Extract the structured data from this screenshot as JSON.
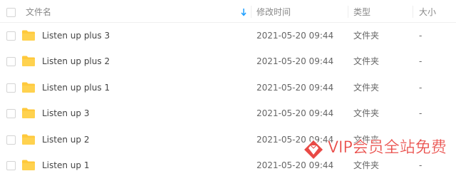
{
  "header": {
    "name_label": "文件名",
    "modified_label": "修改时间",
    "type_label": "类型",
    "size_label": "大小",
    "sort_icon": "sort-arrow-down-icon"
  },
  "rows": [
    {
      "name": "Listen up plus 3",
      "modified": "2021-05-20 09:44",
      "type": "文件夹",
      "size": "-"
    },
    {
      "name": "Listen up plus 2",
      "modified": "2021-05-20 09:44",
      "type": "文件夹",
      "size": "-"
    },
    {
      "name": "Listen up plus 1",
      "modified": "2021-05-20 09:44",
      "type": "文件夹",
      "size": "-"
    },
    {
      "name": "Listen up 3",
      "modified": "2021-05-20 09:44",
      "type": "文件夹",
      "size": "-"
    },
    {
      "name": "Listen up 2",
      "modified": "2021-05-20 09:44",
      "type": "文件夹",
      "size": "-"
    },
    {
      "name": "Listen up 1",
      "modified": "2021-05-20 09:44",
      "type": "文件夹",
      "size": "-"
    }
  ],
  "watermark": {
    "text": "VIP会员全站免费"
  },
  "colors": {
    "folder": "#ffc93c",
    "sort_arrow": "#1e9fff",
    "watermark": "#e83a36"
  }
}
